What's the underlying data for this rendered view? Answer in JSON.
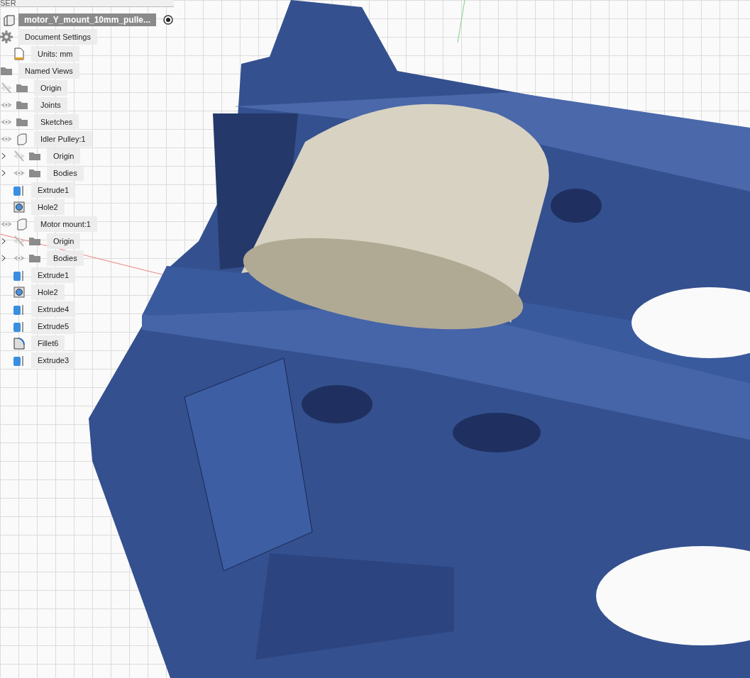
{
  "panel_header": {
    "title": "SER"
  },
  "document": {
    "name": "motor_Y_mount_10mm_pulle...",
    "active": true,
    "children": [
      {
        "label": "Document Settings",
        "kind": "settings",
        "children": [
          {
            "label": "Units: mm",
            "kind": "units"
          }
        ]
      },
      {
        "label": "Named Views",
        "kind": "folder"
      },
      {
        "label": "Origin",
        "kind": "folder",
        "visible": false
      },
      {
        "label": "Joints",
        "kind": "folder",
        "visible": true
      },
      {
        "label": "Sketches",
        "kind": "folder",
        "visible": true
      },
      {
        "label": "Idler Pulley:1",
        "kind": "component",
        "visible": true,
        "children": [
          {
            "label": "Origin",
            "kind": "folder",
            "visible": false,
            "expanded": false
          },
          {
            "label": "Bodies",
            "kind": "folder",
            "visible": true,
            "expanded": false
          },
          {
            "label": "Extrude1",
            "kind": "extrude"
          },
          {
            "label": "Hole2",
            "kind": "hole"
          }
        ]
      },
      {
        "label": "Motor mount:1",
        "kind": "component",
        "visible": true,
        "children": [
          {
            "label": "Origin",
            "kind": "folder",
            "visible": false,
            "expanded": false
          },
          {
            "label": "Bodies",
            "kind": "folder",
            "visible": true,
            "expanded": false
          },
          {
            "label": "Extrude1",
            "kind": "extrude"
          },
          {
            "label": "Hole2",
            "kind": "hole"
          },
          {
            "label": "Extrude4",
            "kind": "extrude"
          },
          {
            "label": "Extrude5",
            "kind": "extrude"
          },
          {
            "label": "Fillet6",
            "kind": "fillet"
          },
          {
            "label": "Extrude3",
            "kind": "extrude"
          }
        ]
      }
    ]
  }
}
